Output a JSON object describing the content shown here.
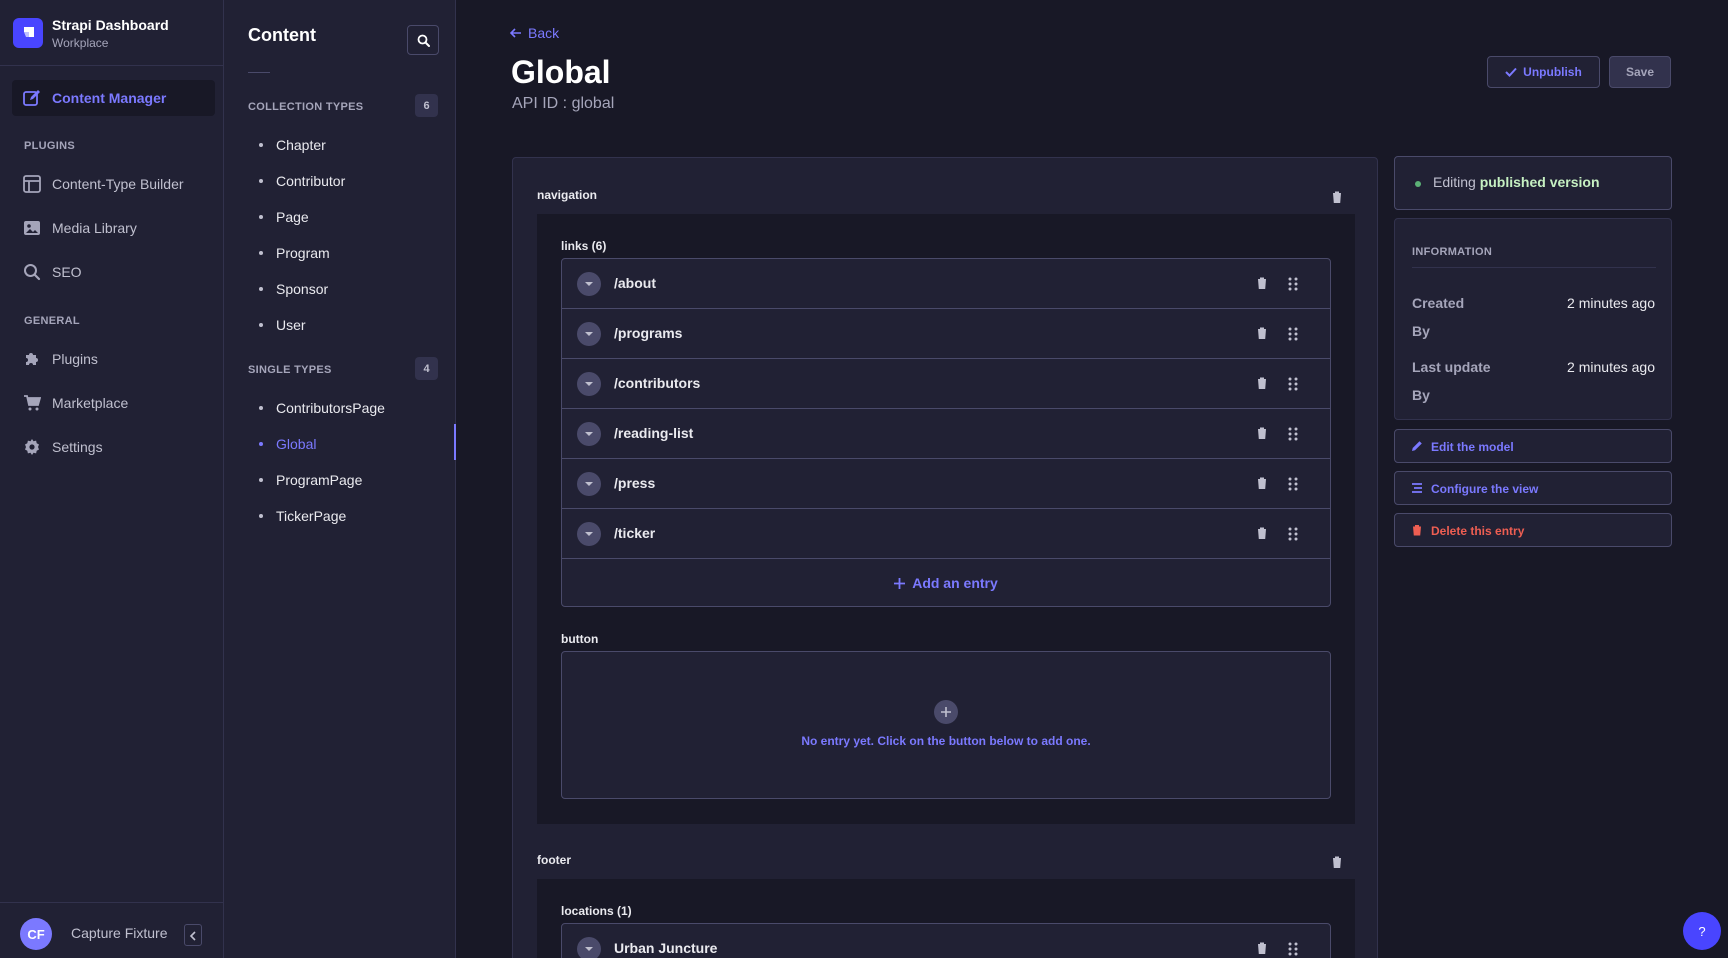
{
  "brand": {
    "title": "Strapi Dashboard",
    "subtitle": "Workplace"
  },
  "mainnav": {
    "active_item": "Content Manager",
    "plugins_section": "PLUGINS",
    "plugins": [
      "Content-Type Builder",
      "Media Library",
      "SEO"
    ],
    "general_section": "GENERAL",
    "general": [
      "Plugins",
      "Marketplace",
      "Settings"
    ]
  },
  "profile": {
    "initials": "CF",
    "name": "Capture Fixture"
  },
  "subnav": {
    "title": "Content",
    "collection_section": "COLLECTION TYPES",
    "collection_count": "6",
    "collection_items": [
      "Chapter",
      "Contributor",
      "Page",
      "Program",
      "Sponsor",
      "User"
    ],
    "single_section": "SINGLE TYPES",
    "single_count": "4",
    "single_items": [
      "ContributorsPage",
      "Global",
      "ProgramPage",
      "TickerPage"
    ],
    "active_item": "Global"
  },
  "header": {
    "back_label": "Back",
    "title": "Global",
    "api_id": "API ID : global",
    "unpublish_label": "Unpublish",
    "save_label": "Save"
  },
  "form": {
    "navigation": {
      "label": "navigation",
      "links_label": "links (6)",
      "links": [
        "/about",
        "/programs",
        "/contributors",
        "/reading-list",
        "/press",
        "/ticker"
      ],
      "add_entry_label": "Add an entry",
      "button_label": "button",
      "empty_text": "No entry yet. Click on the button below to add one."
    },
    "footer": {
      "label": "footer",
      "locations_label": "locations (1)",
      "locations": [
        "Urban Juncture"
      ]
    }
  },
  "sidebar": {
    "status_prefix": "Editing",
    "status_bold": "published version",
    "info_title": "INFORMATION",
    "created_key": "Created",
    "created_val": "2 minutes ago",
    "created_by": "By",
    "updated_key": "Last update",
    "updated_val": "2 minutes ago",
    "updated_by": "By",
    "edit_model": "Edit the model",
    "configure_view": "Configure the view",
    "delete_entry": "Delete this entry"
  },
  "help": {
    "label": "?"
  },
  "colors": {
    "accent": "#7b79ff",
    "brand": "#4945ff",
    "danger": "#ee5e52",
    "success": "#5cb176",
    "background": "#181826",
    "surface": "#212134"
  }
}
